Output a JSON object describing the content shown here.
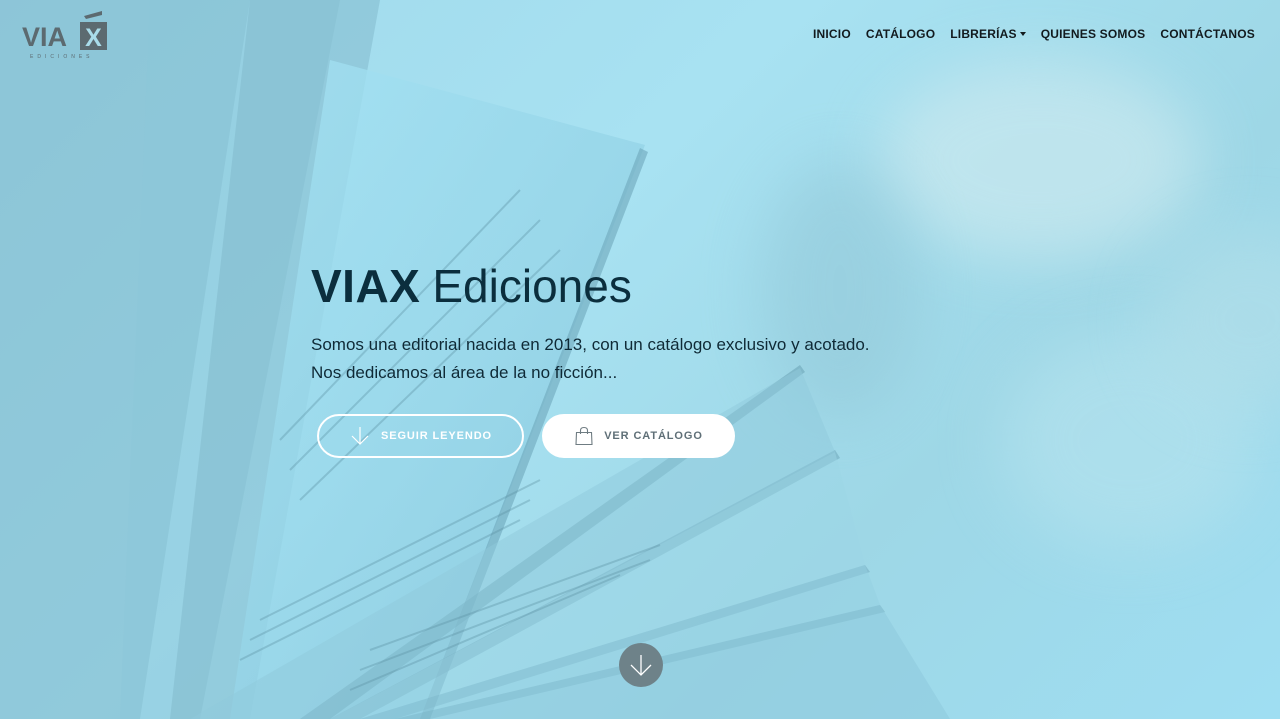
{
  "logo": {
    "text": "VIA",
    "mark": "X",
    "subtitle": "EDICIONES"
  },
  "nav": {
    "items": [
      {
        "label": "INICIO"
      },
      {
        "label": "CATÁLOGO"
      },
      {
        "label": "LIBRERÍAS",
        "dropdown": true
      },
      {
        "label": "QUIENES SOMOS"
      },
      {
        "label": "CONTÁCTANOS"
      }
    ]
  },
  "hero": {
    "title_brand": "VIAX",
    "title_rest": "Ediciones",
    "line1": "Somos una editorial nacida en 2013, con un catálogo exclusivo y acotado.",
    "line2": "Nos dedicamos al área de la no ficción...",
    "btn_read": "SEGUIR LEYENDO",
    "btn_catalog": "VER CATÁLOGO"
  },
  "icons": {
    "read_icon": "arrow-down-icon",
    "catalog_icon": "shopping-bag-icon",
    "scroll_icon": "arrow-down-icon"
  },
  "colors": {
    "overlay": "#9fd8ea",
    "title": "#0b2e3d",
    "button_text_solid": "#5f6f77",
    "scroll_bg": "#6e8289"
  }
}
